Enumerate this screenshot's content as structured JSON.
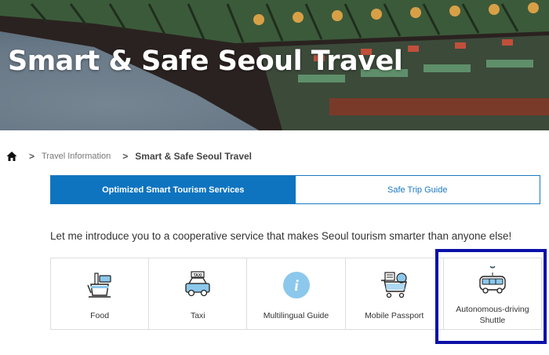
{
  "hero": {
    "title": "Smart & Safe Seoul Travel"
  },
  "breadcrumb": {
    "separator": ">",
    "items": [
      "Travel Information",
      "Smart & Safe Seoul Travel"
    ]
  },
  "tabs": [
    {
      "label": "Optimized Smart Tourism Services",
      "active": true
    },
    {
      "label": "Safe Trip Guide",
      "active": false
    }
  ],
  "intro": "Let me introduce you to a cooperative service that makes Seoul tourism smarter than anyone else!",
  "services": [
    {
      "label": "Food",
      "icon": "food-icon"
    },
    {
      "label": "Taxi",
      "icon": "taxi-icon",
      "icon_text": "TAXI"
    },
    {
      "label": "Multilingual Guide",
      "icon": "info-icon",
      "icon_text": "i"
    },
    {
      "label": "Mobile Passport",
      "icon": "shopping-cart-icon"
    },
    {
      "label": "Autonomous-driving Shuttle",
      "icon": "shuttle-bus-icon"
    }
  ],
  "colors": {
    "accent": "#0e74c0",
    "highlight": "#0b11a8",
    "icon_blue": "#8cc8ec"
  }
}
